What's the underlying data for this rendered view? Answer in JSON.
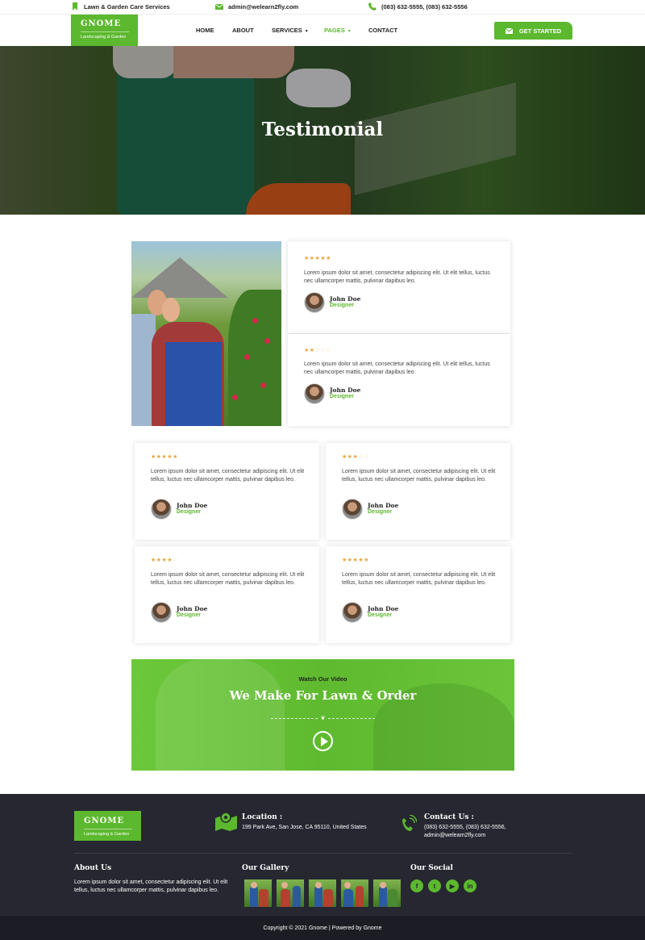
{
  "topbar": {
    "tagline": "Lawn & Garden Care Services",
    "email": "admin@welearn2fly.com",
    "phone": "(083) 632-5555, (083) 632-5556"
  },
  "brand": {
    "name": "GNOME",
    "tagline": "Landscaping & Garden"
  },
  "nav": {
    "items": [
      "HOME",
      "ABOUT",
      "SERVICES",
      "PAGES",
      "CONTACT"
    ],
    "active": "PAGES",
    "cta": "GET STARTED"
  },
  "hero": {
    "title": "Testimonial"
  },
  "testimonials": [
    {
      "rating": 5,
      "text": "Lorem ipsum dolor sit amet, consectetur adipiscing elit. Ut elit tellus, luctus nec ullamcorper mattis, pulvinar dapibus leo.",
      "name": "John Doe",
      "role": "Designer"
    },
    {
      "rating": 2,
      "text": "Lorem ipsum dolor sit amet, consectetur adipiscing elit. Ut elit tellus, luctus nec ullamcorper mattis, pulvinar dapibus leo.",
      "name": "John Doe",
      "role": "Designer"
    },
    {
      "rating": 5,
      "text": "Lorem ipsum dolor sit amet, consectetur adipiscing elit. Ut elit tellus, luctus nec ullamcorper mattis, pulvinar dapibus leo.",
      "name": "John Doe",
      "role": "Designer"
    },
    {
      "rating": 3,
      "text": "Lorem ipsum dolor sit amet, consectetur adipiscing elit. Ut elit tellus, luctus nec ullamcorper mattis, pulvinar dapibus leo.",
      "name": "John Doe",
      "role": "Designer"
    },
    {
      "rating": 4,
      "text": "Lorem ipsum dolor sit amet, consectetur adipiscing elit. Ut elit tellus, luctus nec ullamcorper mattis, pulvinar dapibus leo.",
      "name": "John Doe",
      "role": "Designer"
    },
    {
      "rating": 5,
      "text": "Lorem ipsum dolor sit amet, consectetur adipiscing elit. Ut elit tellus, luctus nec ullamcorper mattis, pulvinar dapibus leo.",
      "name": "John Doe",
      "role": "Designer"
    }
  ],
  "video": {
    "subtitle": "Watch Our Video",
    "title": "We Make For Lawn & Order"
  },
  "footer": {
    "location_title": "Location :",
    "location": "199 Park Ave, San Jose, CA 95110, United States",
    "contact_title": "Contact Us :",
    "contact_phone": "(083) 632-5555, (083) 632-5556,",
    "contact_email": "admin@welearn2fly.com",
    "about_title": "About Us",
    "about_text": "Lorem ipsum dolor sit amet, consectetur adipiscing elit. Ut elit tellus, luctus nec ullamcorper mattis, pulvinar dapibus leo.",
    "gallery_title": "Our Gallery",
    "social_title": "Our Social",
    "social": [
      "facebook-icon",
      "twitter-icon",
      "youtube-icon",
      "linkedin-icon"
    ],
    "copyright": "Copyright © 2021 Gnome | Powered by Gnome"
  },
  "colors": {
    "accent": "#5cb82e",
    "star": "#e7a43c",
    "footer": "#262730"
  }
}
